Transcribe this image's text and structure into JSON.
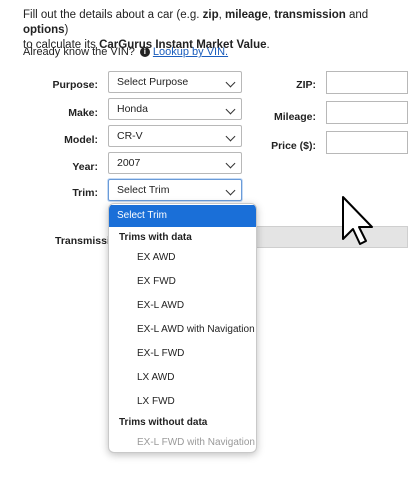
{
  "intro": {
    "line1_prefix": "Fill out the details about a car (e.g. ",
    "zip": "zip",
    "sep1": ", ",
    "mileage": "mileage",
    "sep2": ", ",
    "transmission": "transmission",
    "and": " and ",
    "options": "options",
    "line1_suffix": ")",
    "line2_prefix": "to calculate its ",
    "line2_bold": "CarGurus Instant Market Value",
    "line2_suffix": "."
  },
  "vin": {
    "question": "Already know the VIN?",
    "link": "Lookup by VIN."
  },
  "form": {
    "purpose_label": "Purpose:",
    "purpose_value": "Select Purpose",
    "make_label": "Make:",
    "make_value": "Honda",
    "model_label": "Model:",
    "model_value": "CR-V",
    "year_label": "Year:",
    "year_value": "2007",
    "trim_label": "Trim:",
    "trim_value": "Select Trim",
    "zip_label": "ZIP:",
    "mileage_label": "Mileage:",
    "price_label": "Price ($):",
    "transmission_label": "Transmission"
  },
  "dropdown": {
    "selected": "Select Trim",
    "group_with": "Trims with data",
    "options_with": [
      "EX AWD",
      "EX FWD",
      "EX-L AWD",
      "EX-L AWD with Navigation",
      "EX-L FWD",
      "LX AWD",
      "LX FWD"
    ],
    "group_without": "Trims without data",
    "options_without": [
      "EX-L FWD with Navigation"
    ]
  },
  "colors": {
    "link": "#1a5dbd",
    "highlight": "#1a6fd8"
  },
  "icons": {
    "info": "info-circle-icon",
    "chevron": "chevron-down-icon",
    "cursor": "mouse-pointer-icon"
  }
}
